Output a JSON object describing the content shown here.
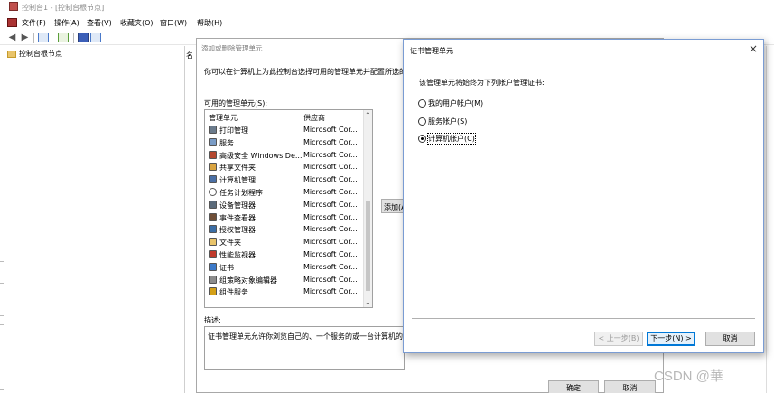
{
  "window": {
    "title": "控制台1 - [控制台根节点]"
  },
  "menu": [
    "文件(F)",
    "操作(A)",
    "查看(V)",
    "收藏夹(O)",
    "窗口(W)",
    "帮助(H)"
  ],
  "tree": {
    "root": "控制台根节点"
  },
  "middle_column_header": "名",
  "add_remove": {
    "title": "添加或删除管理单元",
    "description": "你可以在计算机上为此控制台选择可用的管理单元并配置所选的",
    "available_label": "可用的管理单元(S):",
    "columns": [
      "管理单元",
      "供应商"
    ],
    "items": [
      {
        "name": "打印管理",
        "vendor": "Microsoft Cor...",
        "icon": "printer-icon"
      },
      {
        "name": "服务",
        "vendor": "Microsoft Cor...",
        "icon": "services-icon"
      },
      {
        "name": "高级安全 Windows De...",
        "vendor": "Microsoft Cor...",
        "icon": "firewall-icon"
      },
      {
        "name": "共享文件夹",
        "vendor": "Microsoft Cor...",
        "icon": "shared-folder-icon"
      },
      {
        "name": "计算机管理",
        "vendor": "Microsoft Cor...",
        "icon": "computer-management-icon"
      },
      {
        "name": "任务计划程序",
        "vendor": "Microsoft Cor...",
        "icon": "clock-icon"
      },
      {
        "name": "设备管理器",
        "vendor": "Microsoft Cor...",
        "icon": "device-manager-icon"
      },
      {
        "name": "事件查看器",
        "vendor": "Microsoft Cor...",
        "icon": "event-viewer-icon"
      },
      {
        "name": "授权管理器",
        "vendor": "Microsoft Cor...",
        "icon": "authorization-icon"
      },
      {
        "name": "文件夹",
        "vendor": "Microsoft Cor...",
        "icon": "folder-icon"
      },
      {
        "name": "性能监视器",
        "vendor": "Microsoft Cor...",
        "icon": "performance-icon"
      },
      {
        "name": "证书",
        "vendor": "Microsoft Cor...",
        "icon": "certificate-icon"
      },
      {
        "name": "组策略对象编辑器",
        "vendor": "Microsoft Cor...",
        "icon": "group-policy-icon"
      },
      {
        "name": "组件服务",
        "vendor": "Microsoft Cor...",
        "icon": "component-services-icon"
      }
    ],
    "add_button": "添加(A",
    "desc_label": "描述:",
    "desc_text": "证书管理单元允许你浏览自己的、一个服务的或一台计算机的证",
    "ok": "确定",
    "cancel": "取消"
  },
  "cert_dialog": {
    "title": "证书管理单元",
    "close": "×",
    "prompt": "该管理单元将始终为下列帐户管理证书:",
    "options": [
      {
        "label": "我的用户帐户(M)",
        "selected": false
      },
      {
        "label": "服务帐户(S)",
        "selected": false
      },
      {
        "label": "计算机帐户(C)",
        "selected": true
      }
    ],
    "back": "< 上一步(B)",
    "next": "下一步(N) >",
    "cancel": "取消"
  },
  "watermark": "CSDN @華"
}
